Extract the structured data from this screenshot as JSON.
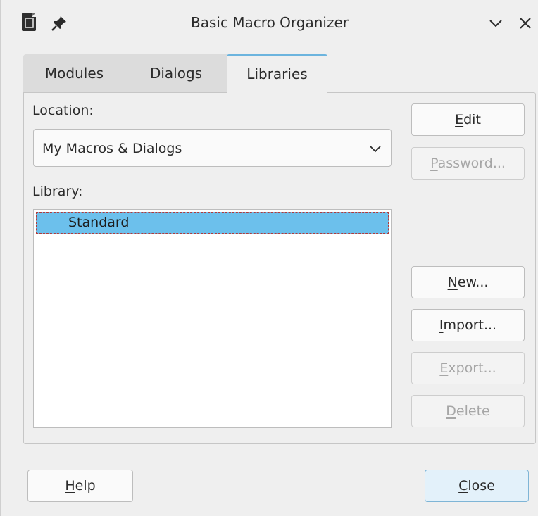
{
  "window": {
    "title": "Basic Macro Organizer"
  },
  "tabs": [
    {
      "label": "Modules",
      "selected": false
    },
    {
      "label": "Dialogs",
      "selected": false
    },
    {
      "label": "Libraries",
      "selected": true
    }
  ],
  "location": {
    "label": "Location:",
    "selected_value": "My Macros & Dialogs"
  },
  "library": {
    "label": "Library:",
    "items": [
      {
        "name": "Standard",
        "selected": true
      }
    ]
  },
  "buttons": {
    "edit": {
      "mnemonic": "E",
      "rest": "dit",
      "enabled": true
    },
    "password": {
      "mnemonic": "P",
      "rest": "assword...",
      "enabled": false
    },
    "new": {
      "mnemonic": "N",
      "rest": "ew...",
      "enabled": true
    },
    "import": {
      "mnemonic": "I",
      "rest": "mport...",
      "enabled": true
    },
    "export": {
      "mnemonic": "E",
      "rest": "xport...",
      "enabled": false
    },
    "delete": {
      "mnemonic": "D",
      "rest": "elete",
      "enabled": false
    },
    "help": {
      "mnemonic": "H",
      "rest": "elp",
      "enabled": true
    },
    "close": {
      "mnemonic": "C",
      "rest": "lose",
      "enabled": true
    }
  },
  "icons": {
    "app": "document-icon",
    "pin": "pin-icon",
    "minimize": "chevron-down-icon",
    "close": "close-icon",
    "combo": "chevron-down-icon"
  },
  "colors": {
    "accent": "#6cb4de",
    "selection": "#6cc0ec",
    "default_button": "#e3f1fa"
  }
}
